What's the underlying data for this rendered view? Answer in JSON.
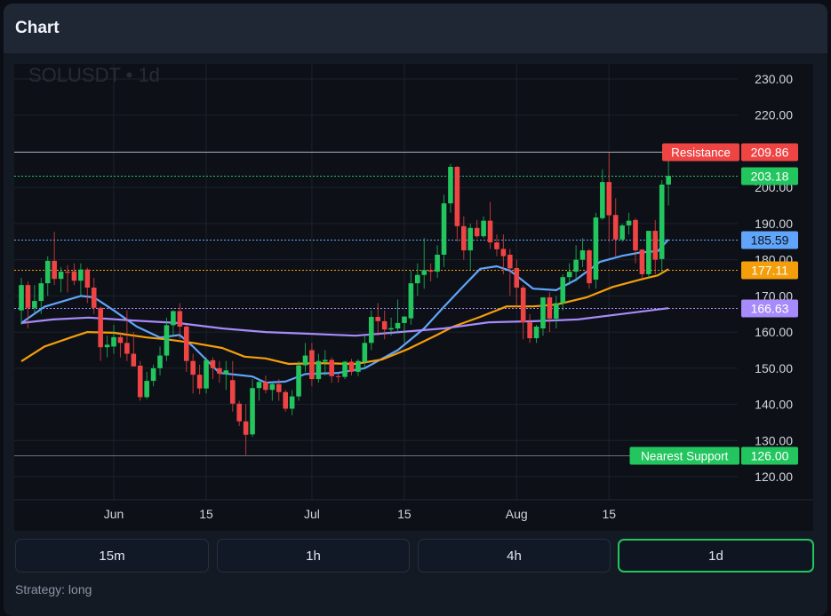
{
  "header": {
    "title": "Chart"
  },
  "watermark": "SOLUSDT • 1d",
  "timeframes": [
    {
      "label": "15m",
      "active": false
    },
    {
      "label": "1h",
      "active": false
    },
    {
      "label": "4h",
      "active": false
    },
    {
      "label": "1d",
      "active": true
    }
  ],
  "strategy_text": "Strategy: long",
  "colors": {
    "up": "#22c55e",
    "down": "#ef4444",
    "ma_fast": "#60a5fa",
    "ma_mid": "#f59e0b",
    "ma_slow": "#a78bfa",
    "grid": "#1c222c",
    "axis_text": "#d1d5db"
  },
  "chart_data": {
    "type": "candlestick",
    "symbol": "SOLUSDT",
    "interval": "1d",
    "ylim": [
      115,
      234
    ],
    "y_ticks": [
      "230.00",
      "220.00",
      "210.00",
      "200.00",
      "190.00",
      "180.00",
      "170.00",
      "160.00",
      "150.00",
      "140.00",
      "130.00",
      "120.00"
    ],
    "x_ticks": [
      {
        "label": "Jun",
        "day": 14
      },
      {
        "label": "15",
        "day": 28
      },
      {
        "label": "Jul",
        "day": 44
      },
      {
        "label": "15",
        "day": 58
      },
      {
        "label": "Aug",
        "day": 75
      },
      {
        "label": "15",
        "day": 89
      }
    ],
    "candles_ohlc": [
      [
        166,
        175,
        162,
        173
      ],
      [
        173,
        174,
        161,
        166.7
      ],
      [
        166.7,
        173,
        165,
        168.6
      ],
      [
        168.6,
        175,
        165,
        173.5
      ],
      [
        173.5,
        181,
        170,
        179.7
      ],
      [
        179.7,
        187.7,
        173,
        174.7
      ],
      [
        174.7,
        178,
        171,
        176.7
      ],
      [
        176.7,
        178.5,
        171,
        176.4
      ],
      [
        176.8,
        179,
        173,
        174.2
      ],
      [
        174.2,
        179,
        170,
        177.3
      ],
      [
        177.3,
        177.8,
        168,
        172.3
      ],
      [
        172.3,
        175,
        165,
        166.7
      ],
      [
        166.7,
        167,
        152,
        155.8
      ],
      [
        155.8,
        159,
        153,
        156.5
      ],
      [
        156,
        162,
        154,
        158.6
      ],
      [
        158.6,
        160,
        153,
        157
      ],
      [
        157,
        166,
        152,
        154
      ],
      [
        154,
        160,
        151,
        150.5
      ],
      [
        150.7,
        152,
        141,
        142
      ],
      [
        142,
        149,
        141.5,
        146.5
      ],
      [
        146.5,
        151,
        145,
        150
      ],
      [
        150,
        156,
        148,
        153.5
      ],
      [
        153.5,
        164,
        152,
        161.9
      ],
      [
        161.9,
        166,
        159,
        165.8
      ],
      [
        165.8,
        168,
        158,
        161.5
      ],
      [
        161.5,
        162,
        149,
        152
      ],
      [
        152,
        154,
        143,
        148.2
      ],
      [
        148.2,
        151,
        142.8,
        144.4
      ],
      [
        144.4,
        153,
        143,
        152.2
      ],
      [
        152.2,
        153,
        147,
        150
      ],
      [
        150,
        152,
        146,
        148.5
      ],
      [
        148.4,
        152,
        144,
        149.4
      ],
      [
        146.7,
        152,
        138,
        140.2
      ],
      [
        140.2,
        141,
        134,
        135.3
      ],
      [
        135.3,
        140,
        126,
        131.6
      ],
      [
        131.7,
        147,
        131,
        144.5
      ],
      [
        144.5,
        147,
        141,
        146.2
      ],
      [
        146.2,
        148,
        143,
        144
      ],
      [
        144,
        146,
        141,
        145.6
      ],
      [
        145.6,
        147,
        141,
        143.4
      ],
      [
        143.4,
        144,
        138,
        138.8
      ],
      [
        138.8,
        144,
        137,
        142.2
      ],
      [
        142.2,
        152,
        141,
        150.8
      ],
      [
        150.8,
        157,
        149,
        153.5
      ],
      [
        155,
        157,
        145,
        147
      ],
      [
        147,
        154,
        146,
        152
      ],
      [
        151.8,
        155,
        148,
        152.3
      ],
      [
        152.3,
        153,
        146,
        147.8
      ],
      [
        147.8,
        148.5,
        146,
        147.6
      ],
      [
        147.6,
        152,
        147,
        151.8
      ],
      [
        151.8,
        152.6,
        148,
        149
      ],
      [
        149,
        152.5,
        147.8,
        152
      ],
      [
        151.7,
        159,
        150,
        157
      ],
      [
        157,
        166,
        155,
        164.2
      ],
      [
        164.2,
        168,
        159,
        163
      ],
      [
        163,
        166,
        158,
        160.7
      ],
      [
        160.7,
        164,
        159,
        161.1
      ],
      [
        161,
        169,
        160,
        162.5
      ],
      [
        162.5,
        164,
        157,
        164.3
      ],
      [
        163.8,
        177,
        162,
        173.5
      ],
      [
        173.5,
        179,
        170,
        175.8
      ],
      [
        175.8,
        186,
        172,
        177.1
      ],
      [
        177.1,
        179,
        174,
        176.7
      ],
      [
        176.7,
        184,
        175,
        181.4
      ],
      [
        181.4,
        198,
        178,
        195.6
      ],
      [
        195.6,
        206.5,
        193,
        205.7
      ],
      [
        205.7,
        206,
        185,
        189.3
      ],
      [
        189.3,
        192,
        180,
        182.6
      ],
      [
        182.6,
        190,
        177,
        188.8
      ],
      [
        188.8,
        191,
        186,
        186.5
      ],
      [
        186.5,
        192,
        186,
        190.8
      ],
      [
        190.8,
        196,
        183,
        184.8
      ],
      [
        184.8,
        187,
        181,
        182.9
      ],
      [
        183,
        187,
        176,
        181
      ],
      [
        181.4,
        183,
        170,
        177.6
      ],
      [
        177.7,
        180,
        167,
        172.3
      ],
      [
        172.3,
        173,
        158,
        162.7
      ],
      [
        162.7,
        165,
        157,
        158.3
      ],
      [
        158.3,
        162,
        157,
        161.5
      ],
      [
        161,
        167,
        159,
        169.6
      ],
      [
        169.6,
        171,
        160,
        163.7
      ],
      [
        163.7,
        170,
        161,
        168
      ],
      [
        168,
        176,
        166,
        175.2
      ],
      [
        175.2,
        179,
        173,
        176.7
      ],
      [
        176.7,
        184,
        174,
        180
      ],
      [
        180,
        186,
        178,
        182.6
      ],
      [
        182.6,
        183,
        172,
        173.5
      ],
      [
        174.5,
        193,
        172,
        191.7
      ],
      [
        191.5,
        205,
        191,
        201.5
      ],
      [
        201.5,
        209.6,
        185,
        192.3
      ],
      [
        192.4,
        197,
        181,
        185.6
      ],
      [
        185.6,
        190,
        185,
        189.5
      ],
      [
        189.5,
        193,
        187,
        190.8
      ],
      [
        191,
        191.5,
        179,
        182.6
      ],
      [
        182.8,
        183,
        175,
        176
      ],
      [
        176,
        188,
        175,
        188
      ],
      [
        188,
        191,
        176,
        180
      ],
      [
        180.2,
        202,
        176,
        200.8
      ],
      [
        200.8,
        207.7,
        195,
        203.2
      ]
    ],
    "moving_averages": [
      {
        "name": "ma_fast",
        "color": "#60a5fa",
        "points": [
          [
            0,
            162.5
          ],
          [
            3.5,
            167
          ],
          [
            9,
            170
          ],
          [
            11,
            169.6
          ],
          [
            14,
            166
          ],
          [
            17.5,
            161.5
          ],
          [
            21,
            158.5
          ],
          [
            24,
            159.2
          ],
          [
            26,
            156
          ],
          [
            30,
            148.7
          ],
          [
            35,
            147.7
          ],
          [
            37,
            146
          ],
          [
            40,
            146.3
          ],
          [
            43,
            148.4
          ],
          [
            48,
            148.7
          ],
          [
            52,
            150
          ],
          [
            57,
            155
          ],
          [
            61,
            161
          ],
          [
            64,
            167
          ],
          [
            67,
            172.8
          ],
          [
            69.5,
            177.5
          ],
          [
            72,
            178.2
          ],
          [
            74,
            177
          ],
          [
            77.5,
            172
          ],
          [
            81,
            171.6
          ],
          [
            84,
            174.5
          ],
          [
            87.6,
            179.4
          ],
          [
            91,
            181.1
          ],
          [
            93.7,
            182
          ],
          [
            96.4,
            182.4
          ],
          [
            98,
            185.6
          ]
        ]
      },
      {
        "name": "ma_mid",
        "color": "#f59e0b",
        "points": [
          [
            0,
            151.9
          ],
          [
            3.5,
            156
          ],
          [
            7.5,
            158.5
          ],
          [
            10,
            160
          ],
          [
            14,
            159.8
          ],
          [
            19,
            158.5
          ],
          [
            22,
            158
          ],
          [
            26,
            157
          ],
          [
            30.4,
            155.6
          ],
          [
            33.8,
            153.2
          ],
          [
            37,
            152.7
          ],
          [
            40.5,
            151.2
          ],
          [
            45,
            151.4
          ],
          [
            50.6,
            151.2
          ],
          [
            54.6,
            152.4
          ],
          [
            58.7,
            155.4
          ],
          [
            62.7,
            159
          ],
          [
            65.4,
            161.5
          ],
          [
            69.5,
            164.2
          ],
          [
            73.5,
            167.1
          ],
          [
            77.5,
            167.1
          ],
          [
            81,
            167.6
          ],
          [
            85.6,
            169.6
          ],
          [
            89.6,
            172.5
          ],
          [
            93.7,
            174.5
          ],
          [
            96.4,
            175.7
          ],
          [
            98,
            177.4
          ]
        ]
      },
      {
        "name": "ma_slow",
        "color": "#a78bfa",
        "points": [
          [
            0,
            162.5
          ],
          [
            4.8,
            163.5
          ],
          [
            10.2,
            164
          ],
          [
            17,
            163.2
          ],
          [
            23.7,
            162.5
          ],
          [
            30.4,
            161
          ],
          [
            37,
            160
          ],
          [
            44,
            159.5
          ],
          [
            50.6,
            159
          ],
          [
            57.3,
            160
          ],
          [
            64,
            161
          ],
          [
            70.8,
            162.7
          ],
          [
            77.5,
            163
          ],
          [
            84.3,
            163.5
          ],
          [
            91,
            165
          ],
          [
            98,
            166.6
          ]
        ]
      }
    ],
    "price_levels": [
      {
        "name": "resistance",
        "label": "Resistance",
        "value": 209.86,
        "value_text": "209.86",
        "color": "#ef4444",
        "line": "solid",
        "line_color": "#9ca3af"
      },
      {
        "name": "last-price",
        "label": "",
        "value": 203.18,
        "value_text": "203.18",
        "color": "#22c55e",
        "line": "dotted",
        "line_color": "#22c55e"
      },
      {
        "name": "ma-fast",
        "label": "",
        "value": 185.59,
        "value_text": "185.59",
        "color": "#60a5fa",
        "line": "dotted",
        "line_color": "#60a5fa",
        "text_color": "#0b1220"
      },
      {
        "name": "ma-mid",
        "label": "",
        "value": 177.11,
        "value_text": "177.11",
        "color": "#f59e0b",
        "line": "dotted",
        "line_color": "#f59e0b"
      },
      {
        "name": "ma-slow",
        "label": "",
        "value": 166.63,
        "value_text": "166.63",
        "color": "#a78bfa",
        "line": "dotted",
        "line_color": "#a78bfa"
      },
      {
        "name": "support",
        "label": "Nearest Support",
        "value": 126.0,
        "value_text": "126.00",
        "color": "#22c55e",
        "line": "solid",
        "line_color": "#6b7280"
      }
    ]
  }
}
